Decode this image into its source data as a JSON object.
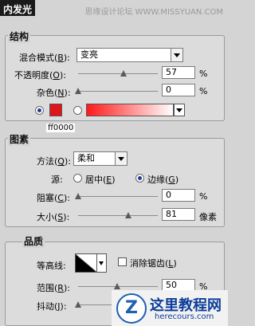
{
  "watermark": "思缘设计论坛  WWW.MISSYUAN.COM",
  "panel_title": "内发光",
  "structure": {
    "legend": "结构",
    "blend_mode_label": "混合模式",
    "blend_mode_key": "B",
    "blend_mode_value": "变亮",
    "opacity_label": "不透明度",
    "opacity_key": "O",
    "opacity_value": "57",
    "opacity_unit": "%",
    "noise_label": "杂色",
    "noise_key": "N",
    "noise_value": "0",
    "noise_unit": "%",
    "color_swatch": "#e0141b",
    "hex_value": "ff0000"
  },
  "elements": {
    "legend": "图素",
    "technique_label": "方法",
    "technique_key": "Q",
    "technique_value": "柔和",
    "source_label": "源:",
    "source_center_label": "居中",
    "source_center_key": "E",
    "source_edge_label": "边缘",
    "source_edge_key": "G",
    "source_selected": "edge",
    "choke_label": "阻塞",
    "choke_key": "C",
    "choke_value": "0",
    "choke_unit": "%",
    "size_label": "大小",
    "size_key": "S",
    "size_value": "81",
    "size_unit": "像素"
  },
  "quality": {
    "legend": "品质",
    "contour_label": "等高线:",
    "antialias_label": "消除锯齿",
    "antialias_key": "L",
    "antialias_checked": false,
    "range_label": "范围",
    "range_key": "R",
    "range_value": "50",
    "range_unit": "%",
    "jitter_label": "抖动",
    "jitter_key": "J"
  },
  "logo": {
    "title": "这里教程网",
    "url": "herecours.com"
  }
}
